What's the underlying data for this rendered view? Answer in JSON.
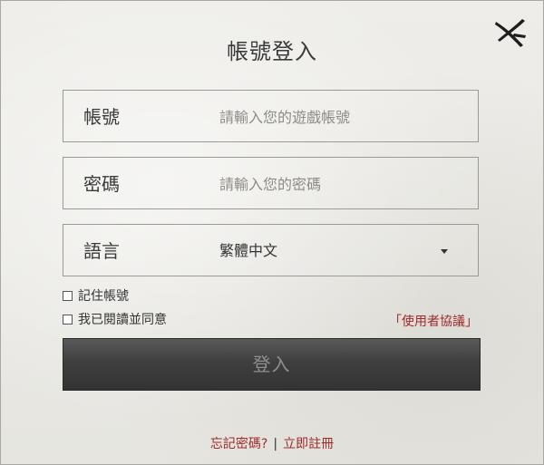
{
  "dialog": {
    "title": "帳號登入",
    "close_icon": "close-x-icon"
  },
  "fields": {
    "account": {
      "label": "帳號",
      "placeholder": "請輸入您的遊戲帳號",
      "value": ""
    },
    "password": {
      "label": "密碼",
      "placeholder": "請輸入您的密碼",
      "value": ""
    },
    "language": {
      "label": "語言",
      "value": "繁體中文",
      "caret_icon": "caret-down-icon"
    }
  },
  "options": {
    "remember_account": {
      "label": "記住帳號",
      "checked": false
    },
    "agree_terms": {
      "label": "我已閱讀並同意",
      "checked": false
    },
    "terms_link": "「使用者協議」"
  },
  "actions": {
    "login_label": "登入",
    "forgot_password": "忘記密碼?",
    "separator": "|",
    "register": "立即註冊"
  },
  "colors": {
    "background": "#e9e8e4",
    "link_red": "#9e2a2a",
    "button_dark": "#3f3f3f"
  }
}
